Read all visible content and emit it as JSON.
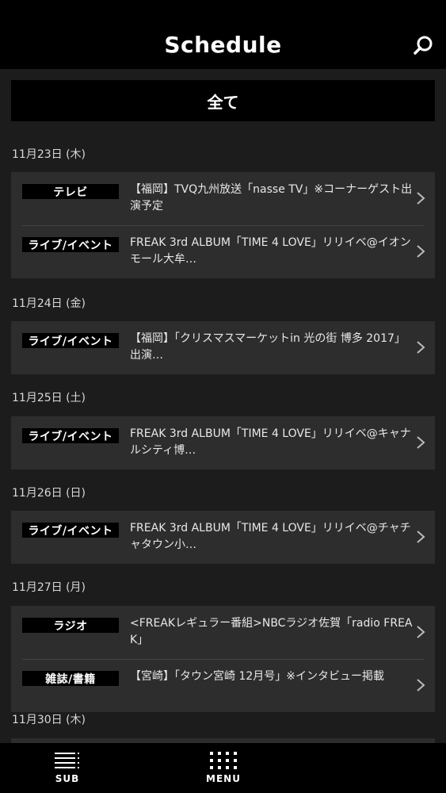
{
  "header": {
    "title": "Schedule",
    "search_icon": "search-icon"
  },
  "filter": {
    "label": "全て"
  },
  "days": [
    {
      "date": "11月23日 (木)",
      "events": [
        {
          "category": "テレビ",
          "text": "【福岡】TVQ九州放送「nasse TV」※コーナーゲスト出演予定"
        },
        {
          "category": "ライブ/イベント",
          "text": "FREAK 3rd ALBUM「TIME 4 LOVE」リリイベ@イオンモール大牟…"
        }
      ]
    },
    {
      "date": "11月24日 (金)",
      "events": [
        {
          "category": "ライブ/イベント",
          "text": "【福岡】「クリスマスマーケットin 光の街 博多 2017」出演…"
        }
      ]
    },
    {
      "date": "11月25日 (土)",
      "events": [
        {
          "category": "ライブ/イベント",
          "text": "FREAK 3rd ALBUM「TIME 4 LOVE」リリイベ@キャナルシティ博…"
        }
      ]
    },
    {
      "date": "11月26日 (日)",
      "events": [
        {
          "category": "ライブ/イベント",
          "text": "FREAK 3rd ALBUM「TIME 4 LOVE」リリイベ@チャチャタウン小…"
        }
      ]
    },
    {
      "date": "11月27日 (月)",
      "events": [
        {
          "category": "ラジオ",
          "text": "<FREAKレギュラー番組>NBCラジオ佐賀「radio FREAK」"
        },
        {
          "category": "雑誌/書籍",
          "text": "【宮崎】「タウン宮崎 12月号」※インタビュー掲載"
        }
      ]
    },
    {
      "date": "11月30日 (木)",
      "events": []
    }
  ],
  "tabbar": {
    "sub_label": "SUB",
    "menu_label": "MENU"
  }
}
